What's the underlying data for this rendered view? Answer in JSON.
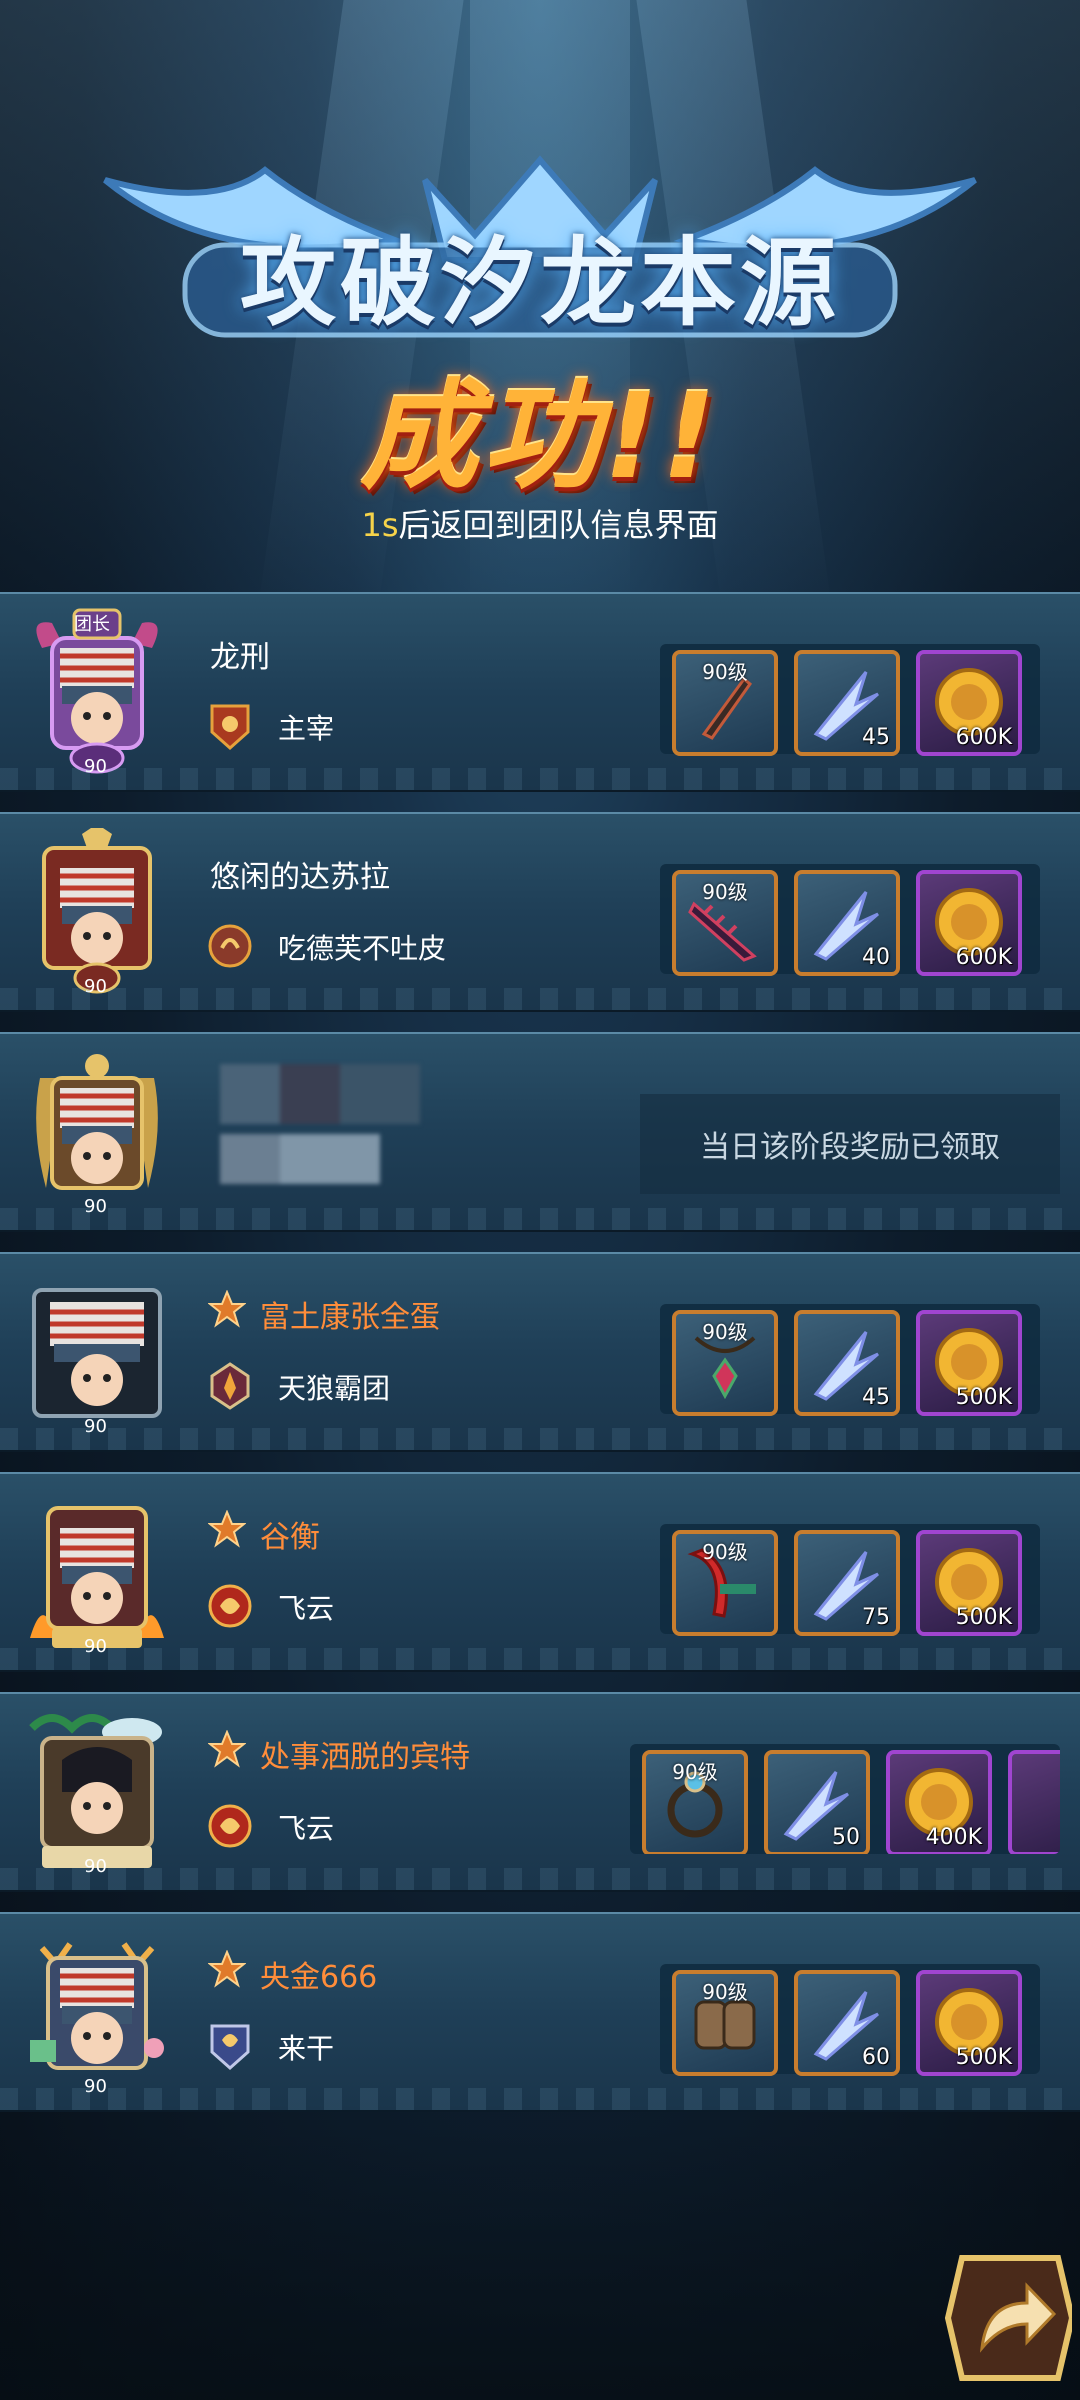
{
  "title": "攻破汐龙本源",
  "result": "成功!!",
  "countdown": {
    "seconds": "1s",
    "text": "后返回到团队信息界面"
  },
  "leader_badge": "团长",
  "rows": [
    {
      "name": "龙刑",
      "guild": "主宰",
      "level": "90",
      "items": [
        {
          "label": "90级",
          "qty": ""
        },
        {
          "label": "",
          "qty": "45"
        },
        {
          "label": "",
          "qty": "600K"
        }
      ]
    },
    {
      "name": "悠闲的达苏拉",
      "guild": "吃德芙不吐皮",
      "level": "90",
      "items": [
        {
          "label": "90级",
          "qty": ""
        },
        {
          "label": "",
          "qty": "40"
        },
        {
          "label": "",
          "qty": "600K"
        }
      ]
    },
    {
      "name": "",
      "guild": "",
      "level": "90",
      "claimed_text": "当日该阶段奖励已领取"
    },
    {
      "name": "富土康张全蛋",
      "guild": "天狼霸团",
      "level": "90",
      "items": [
        {
          "label": "90级",
          "qty": ""
        },
        {
          "label": "",
          "qty": "45"
        },
        {
          "label": "",
          "qty": "500K"
        }
      ]
    },
    {
      "name": "谷衡",
      "guild": "飞云",
      "level": "90",
      "items": [
        {
          "label": "90级",
          "qty": ""
        },
        {
          "label": "",
          "qty": "75"
        },
        {
          "label": "",
          "qty": "500K"
        }
      ]
    },
    {
      "name": "处事洒脱的宾特",
      "guild": "飞云",
      "level": "90",
      "items": [
        {
          "label": "90级",
          "qty": ""
        },
        {
          "label": "",
          "qty": "50"
        },
        {
          "label": "",
          "qty": "400K"
        }
      ]
    },
    {
      "name": "央金666",
      "guild": "来干",
      "level": "90",
      "items": [
        {
          "label": "90级",
          "qty": ""
        },
        {
          "label": "",
          "qty": "60"
        },
        {
          "label": "",
          "qty": "500K"
        }
      ]
    }
  ],
  "colors": {
    "accent": "#ff8d3a",
    "gold": "#f6d34a",
    "slot_orange": "#c87d2e",
    "slot_purple": "#a045d0"
  }
}
